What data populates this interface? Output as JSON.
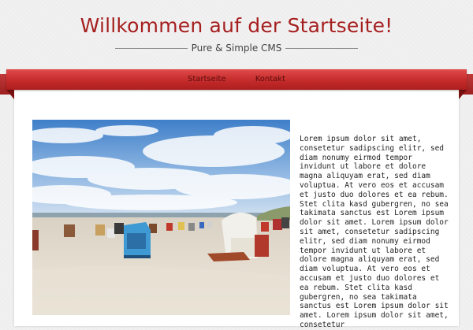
{
  "header": {
    "title": "Willkommen auf der Startseite!",
    "tagline": "Pure & Simple CMS"
  },
  "nav": {
    "items": [
      {
        "label": "Startseite"
      },
      {
        "label": "Kontakt"
      }
    ]
  },
  "content": {
    "text": "Lorem ipsum dolor sit amet, consetetur sadipscing elitr, sed diam nonumy eirmod tempor invidunt ut labore et dolore magna aliquyam erat, sed diam voluptua. At vero eos et accusam et justo duo dolores et ea rebum. Stet clita kasd gubergren, no sea takimata sanctus est Lorem ipsum dolor sit amet. Lorem ipsum dolor sit amet, consetetur sadipscing elitr, sed diam nonumy eirmod tempor invidunt ut labore et dolore magna aliquyam erat, sed diam voluptua. At vero eos et accusam et justo duo dolores et ea rebum. Stet clita kasd gubergren, no sea takimata sanctus est Lorem ipsum dolor sit amet. Lorem ipsum dolor sit amet, consetetur"
  },
  "colors": {
    "title": "#a51f1f",
    "ribbon": "#c52b2b",
    "background": "#f1f1f1"
  }
}
